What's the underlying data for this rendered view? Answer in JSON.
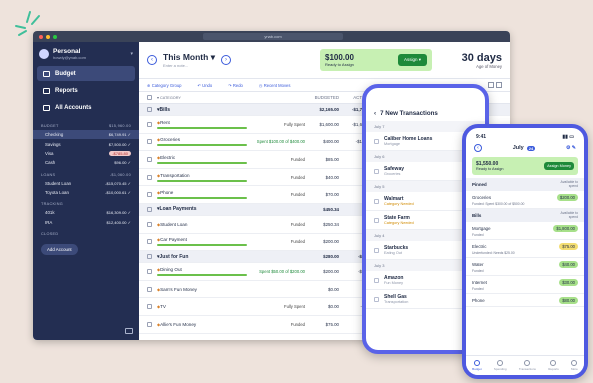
{
  "colors": {
    "background": "#eee3dc",
    "sidebar": "#232e52",
    "accent": "#3b5bdb",
    "phone_frame": "#5a63e8",
    "funded": "#a7e08a",
    "ready_to_assign": "#c7f0b3"
  },
  "browser": {
    "url": "ynab.com"
  },
  "sidebar": {
    "budget_name": "Personal",
    "email": "howdy@ynab.com",
    "nav": [
      {
        "label": "Budget",
        "icon": "budget-icon"
      },
      {
        "label": "Reports",
        "icon": "reports-icon"
      },
      {
        "label": "All Accounts",
        "icon": "accounts-icon"
      }
    ],
    "groups": [
      {
        "label": "BUDGET",
        "total": "$15,960.00",
        "accounts": [
          {
            "name": "Checking",
            "balance": "$6,749.91 ✓"
          },
          {
            "name": "Savings",
            "balance": "$7,500.00 ✓"
          },
          {
            "name": "Visa",
            "balance": "-$785.80"
          },
          {
            "name": "Cash",
            "balance": "$96.00 ✓"
          }
        ]
      },
      {
        "label": "LOANS",
        "total": "-$1,060.00",
        "accounts": [
          {
            "name": "Student Loan",
            "balance": "-$15,070.45 ✓"
          },
          {
            "name": "Toyota Loan",
            "balance": "-$10,000.61 ✓"
          }
        ]
      },
      {
        "label": "TRACKING",
        "total": "",
        "accounts": [
          {
            "name": "401k",
            "balance": "$16,309.00 ✓"
          },
          {
            "name": "IRA",
            "balance": "$12,400.00 ✓"
          }
        ]
      },
      {
        "label": "CLOSED",
        "total": "",
        "accounts": []
      }
    ],
    "add_account": "Add Account"
  },
  "header": {
    "month": "This Month",
    "note": "Enter a note...",
    "rta_amount": "$100.00",
    "rta_label": "Ready to Assign",
    "assign_button": "Assign",
    "aom_value": "30 days",
    "aom_label": "Age of Money"
  },
  "toolbar": {
    "category_group": "Category Group",
    "undo": "Undo",
    "redo": "Redo",
    "recent": "Recent Moves"
  },
  "columns": {
    "category": "CATEGORY",
    "budgeted": "BUDGETED",
    "activity": "ACTIVITY",
    "available": "AVAILABLE"
  },
  "rows": [
    {
      "type": "group",
      "name": "Bills",
      "budgeted": "$2,165.00",
      "activity": "-$1,700.00",
      "available": "$555.00"
    },
    {
      "type": "cat",
      "name": "Rent",
      "status": "Fully Spent",
      "budgeted": "$1,600.00",
      "activity": "-$1,600.00",
      "available": "$0.00",
      "pill": "gray",
      "bar": "green"
    },
    {
      "type": "cat",
      "name": "Groceries",
      "status": "Spent $100.00 of $400.00",
      "budgeted": "$400.00",
      "activity": "-$100.00",
      "available": "$300.00",
      "pill": "green",
      "bar": "green"
    },
    {
      "type": "cat",
      "name": "Electric",
      "status": "Funded",
      "budgeted": "$85.00",
      "activity": "$0.00",
      "available": "$85.00",
      "pill": "green",
      "bar": "green"
    },
    {
      "type": "cat",
      "name": "Transportation",
      "status": "Funded",
      "budgeted": "$40.00",
      "activity": "$0.00",
      "available": "$100.00",
      "pill": "green",
      "bar": "green"
    },
    {
      "type": "cat",
      "name": "Phone",
      "status": "Funded",
      "budgeted": "$70.00",
      "activity": "$0.00",
      "available": "$70.00",
      "pill": "green",
      "bar": "green"
    },
    {
      "type": "group",
      "name": "Loan Payments",
      "budgeted": "$450.34",
      "activity": "$0.00",
      "available": "$450.34"
    },
    {
      "type": "cat",
      "name": "Student Loan",
      "status": "Funded",
      "budgeted": "$250.34",
      "activity": "$0.00",
      "available": "$250.34",
      "pill": "green",
      "bar": ""
    },
    {
      "type": "cat",
      "name": "Car Payment",
      "status": "Funded",
      "budgeted": "$200.00",
      "activity": "$0.00",
      "available": "$200.00",
      "pill": "green",
      "bar": "green"
    },
    {
      "type": "group",
      "name": "Just for Fun",
      "budgeted": "$280.00",
      "activity": "-$50.00",
      "available": "$517.00"
    },
    {
      "type": "cat",
      "name": "Dining Out",
      "status": "Spent $50.00 of $200.00",
      "budgeted": "$200.00",
      "activity": "-$50.00",
      "available": "$150.00",
      "pill": "green",
      "bar": "green"
    },
    {
      "type": "cat",
      "name": "Sam's Fun Money",
      "status": "",
      "budgeted": "$0.00",
      "activity": "$0.00",
      "available": "$75.00",
      "pill": "green",
      "bar": ""
    },
    {
      "type": "cat",
      "name": "TV",
      "status": "Fully Spent",
      "budgeted": "$0.00",
      "activity": "-$5.00",
      "available": "$0.00",
      "pill": "gray",
      "bar": ""
    },
    {
      "type": "cat",
      "name": "Allie's Fun Money",
      "status": "Funded",
      "budgeted": "$75.00",
      "activity": "$0.00",
      "available": "$75.00",
      "pill": "green",
      "bar": ""
    }
  ],
  "phone1": {
    "title": "7 New Transactions",
    "entries": [
      {
        "date": "July 7"
      },
      {
        "payee": "Caliber Home Loans",
        "category": "Mortgage",
        "warn": false
      },
      {
        "date": "July 6"
      },
      {
        "payee": "Safeway",
        "category": "Groceries",
        "warn": false
      },
      {
        "date": "July 5"
      },
      {
        "payee": "Walmart",
        "category": "Category Needed",
        "warn": true
      },
      {
        "payee": "State Farm",
        "category": "Category Needed",
        "warn": true
      },
      {
        "date": "July 4"
      },
      {
        "payee": "Starbucks",
        "category": "Eating Out",
        "warn": false
      },
      {
        "date": "July 3"
      },
      {
        "payee": "Amazon",
        "category": "Fun Money",
        "warn": false
      },
      {
        "payee": "Shell Gas",
        "category": "Transportation",
        "warn": false
      }
    ]
  },
  "phone2": {
    "time": "9:41",
    "month": "July",
    "year_badge": "24",
    "rta_amount": "$1,550.00",
    "rta_label": "Ready to Assign",
    "assign_button": "Assign Money",
    "groups": [
      {
        "name": "Pinned",
        "col": "Available to spend",
        "cats": [
          {
            "name": "Groceries",
            "available": "$200.00",
            "sub": "Funded: Spent $300.00 of $500.00",
            "pill": "green"
          }
        ]
      },
      {
        "name": "Bills",
        "col": "Available to spend",
        "cats": [
          {
            "name": "Mortgage",
            "available": "$1,800.00",
            "sub": "Funded",
            "pill": "green"
          },
          {
            "name": "Electric",
            "available": "$75.00",
            "sub": "Underfunded: Needs $25.00",
            "pill": "yellow"
          },
          {
            "name": "Water",
            "available": "$40.00",
            "sub": "Funded",
            "pill": "green"
          },
          {
            "name": "Internet",
            "available": "$30.00",
            "sub": "Funded",
            "pill": "green"
          },
          {
            "name": "Phone",
            "available": "$80.00",
            "sub": "",
            "pill": "green"
          }
        ]
      }
    ],
    "tabs": [
      "Budget",
      "Spending",
      "Transactions",
      "Reports",
      "More"
    ]
  }
}
